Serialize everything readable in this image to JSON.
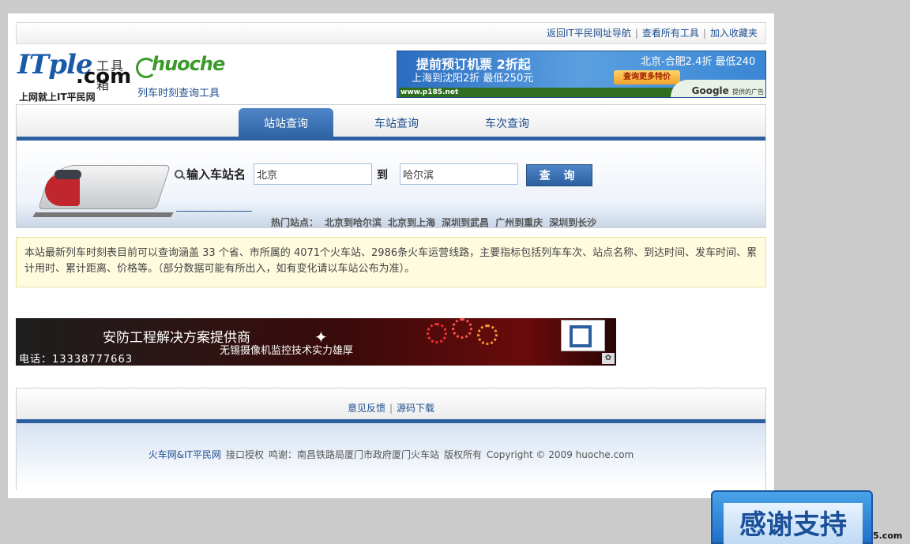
{
  "topbar": {
    "link1": "返回IT平民网址导航",
    "link2": "查看所有工具",
    "link3": "加入收藏夹"
  },
  "logo": {
    "itple": "ITple",
    "dotcom": ".com",
    "tool": "工具箱",
    "slogan": "上网就上IT平民网"
  },
  "huoche": {
    "name": "huoche",
    "subtitle": "列车时刻查询工具"
  },
  "ad_top": {
    "line1": "提前预订机票 2折起",
    "line2": "上海到沈阳2折 最低250元",
    "line3": "北京-合肥2.4折 最低240",
    "button": "查询更多特价",
    "site": "www.p185.net",
    "google": "Google",
    "google_sub": "提供的广告"
  },
  "tabs": [
    {
      "label": "站站查询"
    },
    {
      "label": "车站查询"
    },
    {
      "label": "车次查询"
    }
  ],
  "search": {
    "label": "输入车站名",
    "from_value": "北京",
    "to_label": "到",
    "to_value": "哈尔滨",
    "button": "查 询",
    "hot_label": "热门站点：",
    "hot_links": [
      "北京到哈尔滨",
      "北京到上海",
      "深圳到武昌",
      "广州到重庆",
      "深圳到长沙"
    ]
  },
  "notice": {
    "text": "本站最新列车时刻表目前可以查询涵盖 33 个省、市所属的 4071个火车站、2986条火车运营线路，主要指标包括列车车次、站点名称、到达时间、发车时间、累计用时、累计距离、价格等。（部分数据可能有所出入，如有变化请以车站公布为准）。"
  },
  "banner": {
    "title": "安防工程解决方案提供商",
    "subtitle": "无锡摄像机监控技术实力雄厚",
    "phone": "电话：13338777663"
  },
  "footer": {
    "feedback": "意见反馈",
    "source": "源码下载",
    "brand": "火车网&IT平民网",
    "license": "接口授权",
    "thanks": "鸣谢：南昌铁路局厦门市政府厦门火车站",
    "rights": "版权所有",
    "copyright": "Copyright © 2009 huoche.com"
  },
  "thanks_badge": {
    "text": "感谢支持",
    "url": "5.com"
  },
  "colors": {
    "accent": "#2c5fa0",
    "notice_bg": "#fffbdf"
  }
}
